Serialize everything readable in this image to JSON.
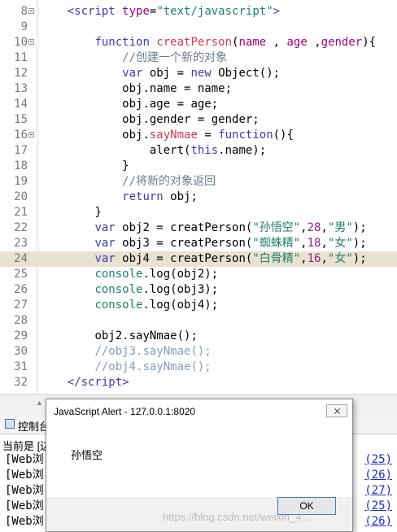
{
  "editor": {
    "lines": [
      {
        "n": "8",
        "fold": true,
        "indent": "    ",
        "tokens": [
          {
            "t": "<",
            "c": "tag"
          },
          {
            "t": "script",
            "c": "tag"
          },
          {
            "t": " ",
            "c": ""
          },
          {
            "t": "type",
            "c": "attr"
          },
          {
            "t": "=",
            "c": ""
          },
          {
            "t": "\"text/javascript\"",
            "c": "str"
          },
          {
            "t": ">",
            "c": "tag"
          }
        ]
      },
      {
        "n": "9",
        "indent": "",
        "tokens": []
      },
      {
        "n": "10",
        "fold": true,
        "indent": "        ",
        "tokens": [
          {
            "t": "function",
            "c": "kw"
          },
          {
            "t": " ",
            "c": ""
          },
          {
            "t": "creatPerson",
            "c": "fn"
          },
          {
            "t": "(",
            "c": ""
          },
          {
            "t": "name",
            "c": "attr"
          },
          {
            "t": " , ",
            "c": ""
          },
          {
            "t": "age",
            "c": "attr"
          },
          {
            "t": " ,",
            "c": ""
          },
          {
            "t": "gender",
            "c": "attr"
          },
          {
            "t": "){",
            "c": ""
          }
        ]
      },
      {
        "n": "11",
        "indent": "            ",
        "tokens": [
          {
            "t": "//创建一个新的对象",
            "c": "cm"
          }
        ]
      },
      {
        "n": "12",
        "indent": "            ",
        "tokens": [
          {
            "t": "var",
            "c": "kw"
          },
          {
            "t": " obj = ",
            "c": ""
          },
          {
            "t": "new",
            "c": "kw"
          },
          {
            "t": " Object();",
            "c": ""
          }
        ]
      },
      {
        "n": "13",
        "indent": "            ",
        "tokens": [
          {
            "t": "obj.name = name;",
            "c": ""
          }
        ]
      },
      {
        "n": "14",
        "indent": "            ",
        "tokens": [
          {
            "t": "obj.age = age;",
            "c": ""
          }
        ]
      },
      {
        "n": "15",
        "indent": "            ",
        "tokens": [
          {
            "t": "obj.gender = gender;",
            "c": ""
          }
        ]
      },
      {
        "n": "16",
        "fold": true,
        "indent": "            ",
        "tokens": [
          {
            "t": "obj.",
            "c": ""
          },
          {
            "t": "sayNmae",
            "c": "prop"
          },
          {
            "t": " = ",
            "c": ""
          },
          {
            "t": "function",
            "c": "kw"
          },
          {
            "t": "(){",
            "c": ""
          }
        ]
      },
      {
        "n": "17",
        "indent": "                ",
        "tokens": [
          {
            "t": "alert(",
            "c": ""
          },
          {
            "t": "this",
            "c": "kw"
          },
          {
            "t": ".name);",
            "c": ""
          }
        ]
      },
      {
        "n": "18",
        "indent": "            ",
        "tokens": [
          {
            "t": "}",
            "c": ""
          }
        ]
      },
      {
        "n": "19",
        "indent": "            ",
        "tokens": [
          {
            "t": "//将新的对象返回",
            "c": "cm"
          }
        ]
      },
      {
        "n": "20",
        "indent": "            ",
        "tokens": [
          {
            "t": "return",
            "c": "kw"
          },
          {
            "t": " obj;",
            "c": ""
          }
        ]
      },
      {
        "n": "21",
        "indent": "        ",
        "tokens": [
          {
            "t": "}",
            "c": ""
          }
        ]
      },
      {
        "n": "22",
        "indent": "        ",
        "tokens": [
          {
            "t": "var",
            "c": "kw"
          },
          {
            "t": " obj2 = creatPerson(",
            "c": ""
          },
          {
            "t": "\"孙悟空\"",
            "c": "str"
          },
          {
            "t": ",",
            "c": ""
          },
          {
            "t": "28",
            "c": "num"
          },
          {
            "t": ",",
            "c": ""
          },
          {
            "t": "\"男\"",
            "c": "str"
          },
          {
            "t": ");",
            "c": ""
          }
        ]
      },
      {
        "n": "23",
        "indent": "        ",
        "tokens": [
          {
            "t": "var",
            "c": "kw"
          },
          {
            "t": " obj3 = creatPerson(",
            "c": ""
          },
          {
            "t": "\"蜘蛛精\"",
            "c": "str"
          },
          {
            "t": ",",
            "c": ""
          },
          {
            "t": "18",
            "c": "num"
          },
          {
            "t": ",",
            "c": ""
          },
          {
            "t": "\"女\"",
            "c": "str"
          },
          {
            "t": ");",
            "c": ""
          }
        ]
      },
      {
        "n": "24",
        "current": true,
        "indent": "        ",
        "tokens": [
          {
            "t": "var",
            "c": "kw"
          },
          {
            "t": " obj4 = creatPerson(",
            "c": ""
          },
          {
            "t": "\"白骨精\"",
            "c": "str"
          },
          {
            "t": ",",
            "c": ""
          },
          {
            "t": "16",
            "c": "num"
          },
          {
            "t": ",",
            "c": ""
          },
          {
            "t": "\"女\"",
            "c": "str"
          },
          {
            "t": ");",
            "c": ""
          }
        ]
      },
      {
        "n": "25",
        "indent": "        ",
        "tokens": [
          {
            "t": "console",
            "c": "str"
          },
          {
            "t": ".log(obj2);",
            "c": ""
          }
        ]
      },
      {
        "n": "26",
        "indent": "        ",
        "tokens": [
          {
            "t": "console",
            "c": "str"
          },
          {
            "t": ".log(obj3);",
            "c": ""
          }
        ]
      },
      {
        "n": "27",
        "indent": "        ",
        "tokens": [
          {
            "t": "console",
            "c": "str"
          },
          {
            "t": ".log(obj4);",
            "c": ""
          }
        ]
      },
      {
        "n": "28",
        "indent": "",
        "tokens": []
      },
      {
        "n": "29",
        "indent": "        ",
        "tokens": [
          {
            "t": "obj2.sayNmae();",
            "c": ""
          }
        ]
      },
      {
        "n": "30",
        "indent": "        ",
        "tokens": [
          {
            "t": "//obj3.sayNmae();",
            "c": "dim"
          }
        ]
      },
      {
        "n": "31",
        "indent": "        ",
        "tokens": [
          {
            "t": "//obj4.sayNmae();",
            "c": "dim"
          }
        ]
      },
      {
        "n": "32",
        "indent": "    ",
        "tokens": [
          {
            "t": "</",
            "c": "tag"
          },
          {
            "t": "script",
            "c": "tag"
          },
          {
            "t": ">",
            "c": "tag"
          }
        ]
      }
    ]
  },
  "console": {
    "tab_label": "控制台",
    "status": "当前是 [边",
    "rows": [
      {
        "left": "[Web浏",
        "right": "(25)"
      },
      {
        "left": "[Web浏",
        "right": "(26)"
      },
      {
        "left": "[Web浏",
        "right": "(27)"
      },
      {
        "left": "[Web浏",
        "right": "(25)"
      },
      {
        "left": "[Web浏",
        "right": "(26)"
      }
    ]
  },
  "dialog": {
    "title": "JavaScript Alert - 127.0.0.1:8020",
    "message": "孙悟空",
    "ok_label": "OK"
  },
  "watermark": "https://blog.csdn.net/weixin_4..."
}
